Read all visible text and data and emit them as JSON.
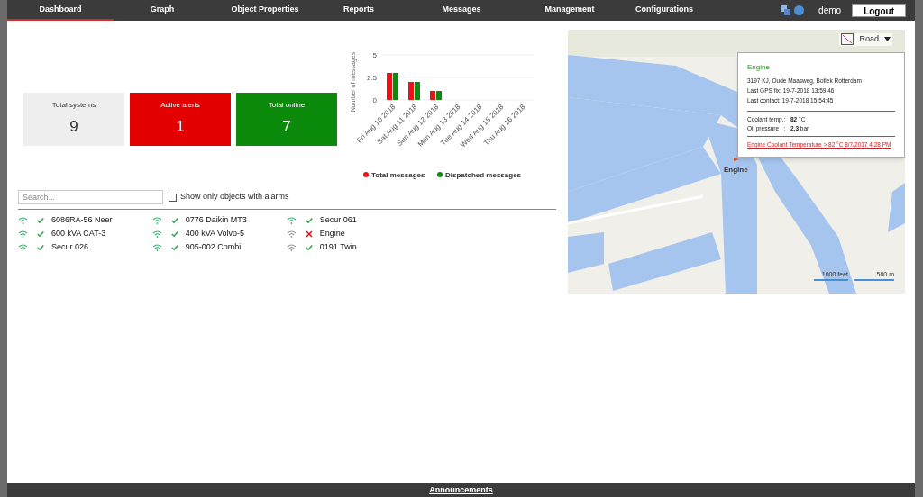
{
  "nav": {
    "items": [
      {
        "label": "Dashboard",
        "selected": true
      },
      {
        "label": "Graph",
        "selected": false
      },
      {
        "label": "Object Properties",
        "selected": false
      },
      {
        "label": "Reports",
        "selected": false
      },
      {
        "label": "Messages",
        "selected": false
      },
      {
        "label": "Management",
        "selected": false
      },
      {
        "label": "Configurations",
        "selected": false
      }
    ],
    "user": "demo",
    "logout": "Logout"
  },
  "tiles": [
    {
      "label": "Total systems",
      "value": "9",
      "kind": "neutral"
    },
    {
      "label": "Active alerts",
      "value": "1",
      "kind": "alert"
    },
    {
      "label": "Total online",
      "value": "7",
      "kind": "online"
    }
  ],
  "chart": {
    "chart_data": {
      "type": "bar",
      "legend": "bottom",
      "ylabel": "Number of messages",
      "categories": [
        "Fri Aug 10 2018",
        "Sat Aug 11 2018",
        "Sun Aug 12 2018",
        "Mon Aug 13 2018",
        "Tue Aug 14 2018",
        "Wed Aug 15 2018",
        "Thu Aug 16 2018"
      ],
      "ylim": [
        0,
        5
      ],
      "yticks": [
        0,
        {
          "value": 2.5,
          "label": "2.5"
        },
        5
      ],
      "series": [
        {
          "name": "Total messages",
          "color": "#e8141b",
          "values": [
            3,
            2,
            1,
            0,
            0,
            0,
            0
          ]
        },
        {
          "name": "Dispatched messages",
          "color": "#0d8a12",
          "values": [
            3,
            2,
            1,
            0,
            0,
            0,
            0
          ]
        }
      ]
    }
  },
  "filter": {
    "search_placeholder": "Search...",
    "alarms_only": {
      "label": "Show only objects with alarms",
      "checked": false
    }
  },
  "objects": [
    {
      "name": "6086RA-56 Neer",
      "online": true,
      "alarm": false
    },
    {
      "name": "600 kVA CAT-3",
      "online": true,
      "alarm": false
    },
    {
      "name": "Secur 026",
      "online": true,
      "alarm": false
    },
    {
      "name": "0776 Daikin MT3",
      "online": true,
      "alarm": false
    },
    {
      "name": "400 kVA Volvo-5",
      "online": true,
      "alarm": false
    },
    {
      "name": "905-002 Combi",
      "online": true,
      "alarm": false
    },
    {
      "name": "Secur 061",
      "online": true,
      "alarm": false
    },
    {
      "name": "Engine",
      "online": false,
      "alarm": true
    },
    {
      "name": "0191 Twin",
      "online": false,
      "alarm": false
    }
  ],
  "map": {
    "map_type": "Road",
    "marker_label": "Engine",
    "popup": {
      "title": "Engine",
      "address": "3197 KJ, Oude Maasweg, Botlek Rotterdam",
      "last_gps_fix": "Last GPS fix: 19-7-2018 13:59:46",
      "last_contact": "Last contact: 19-7-2018 15:54:45",
      "readings": [
        {
          "label": "Coolant temp.:",
          "value": "**82** °C"
        },
        {
          "label": "Oil pressure   :",
          "value": "**2,3** bar"
        }
      ],
      "alert_link": "Engine Coolant Temperature > 82 °C 8/7/2017 4:28 PM"
    },
    "scale": [
      "1000 feet",
      "500 m"
    ]
  },
  "footer": {
    "link": "Announcements"
  }
}
